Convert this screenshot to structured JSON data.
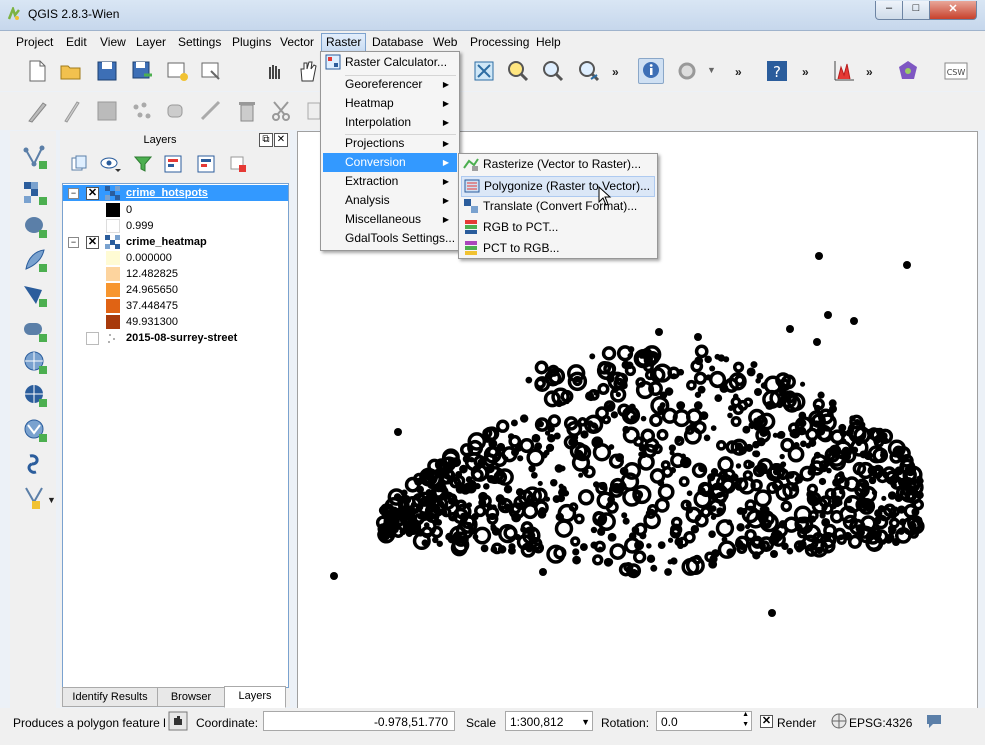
{
  "window": {
    "title": "QGIS 2.8.3-Wien",
    "min_label": "–",
    "max_label": "□",
    "close_label": "✕"
  },
  "menubar": [
    "Project",
    "Edit",
    "View",
    "Layer",
    "Settings",
    "Plugins",
    "Vector",
    "Raster",
    "Database",
    "Web",
    "Processing",
    "Help"
  ],
  "raster_menu": {
    "items": [
      {
        "label": "Raster Calculator...",
        "submenu": false
      },
      {
        "label": "Georeferencer",
        "submenu": true
      },
      {
        "label": "Heatmap",
        "submenu": true
      },
      {
        "label": "Interpolation",
        "submenu": true
      },
      {
        "label": "Projections",
        "submenu": true
      },
      {
        "label": "Conversion",
        "submenu": true
      },
      {
        "label": "Extraction",
        "submenu": true
      },
      {
        "label": "Analysis",
        "submenu": true
      },
      {
        "label": "Miscellaneous",
        "submenu": true
      },
      {
        "label": "GdalTools Settings...",
        "submenu": false
      }
    ]
  },
  "conversion_submenu": {
    "items": [
      {
        "label": "Rasterize (Vector to Raster)..."
      },
      {
        "label": "Polygonize (Raster to Vector)..."
      },
      {
        "label": "Translate (Convert Format)..."
      },
      {
        "label": "RGB to PCT..."
      },
      {
        "label": "PCT to RGB..."
      }
    ]
  },
  "layers_panel": {
    "title": "Layers",
    "float_btn": "⧉",
    "close_btn": "✕",
    "layers": [
      {
        "name": "crime_hotspots",
        "checked": true,
        "expanded": true,
        "selected": true,
        "legend": [
          {
            "label": "0",
            "color": "#000000"
          },
          {
            "label": "0.999",
            "color": "#ffffff"
          }
        ]
      },
      {
        "name": "crime_heatmap",
        "checked": true,
        "expanded": true,
        "selected": false,
        "legend": [
          {
            "label": "0.000000",
            "color": "#fffbd4"
          },
          {
            "label": "12.482825",
            "color": "#fdd49e"
          },
          {
            "label": "24.965650",
            "color": "#f7962f"
          },
          {
            "label": "37.448475",
            "color": "#e06314"
          },
          {
            "label": "49.931300",
            "color": "#a83a0b"
          }
        ]
      },
      {
        "name": "2015-08-surrey-street",
        "checked": false,
        "expanded": false,
        "selected": false,
        "legend": []
      }
    ],
    "tabs": [
      "Identify Results",
      "Browser",
      "Layers"
    ],
    "active_tab": "Layers"
  },
  "statusbar": {
    "message": "Produces a polygon feature layer",
    "coordinate_label": "Coordinate:",
    "coordinate_value": "-0.978,51.770",
    "scale_label": "Scale",
    "scale_value": "1:300,812",
    "rotation_label": "Rotation:",
    "rotation_value": "0.0",
    "render_label": "Render",
    "render_checked": true,
    "crs_label": "EPSG:4326"
  },
  "colors": {
    "selection": "#3399ff",
    "canvas_bg": "#ffffff",
    "map_points": "#000000"
  }
}
